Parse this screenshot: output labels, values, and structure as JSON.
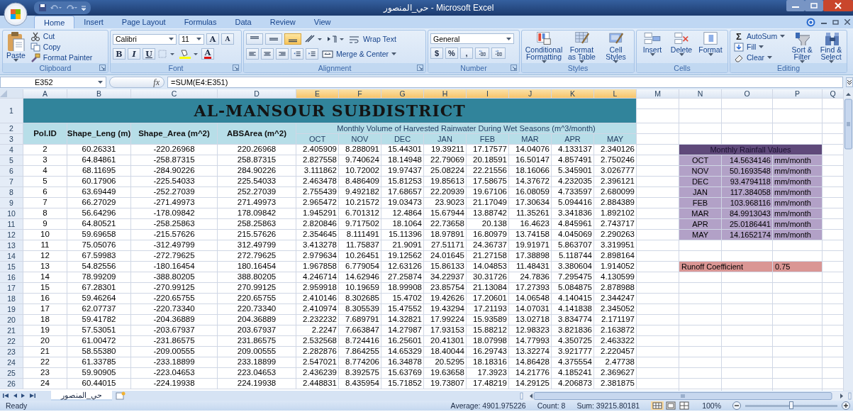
{
  "window": {
    "title": "حي_المنصور - Microsoft Excel"
  },
  "ribbon_tabs": [
    {
      "label": "Home",
      "selected": true
    },
    {
      "label": "Insert",
      "selected": false
    },
    {
      "label": "Page Layout",
      "selected": false
    },
    {
      "label": "Formulas",
      "selected": false
    },
    {
      "label": "Data",
      "selected": false
    },
    {
      "label": "Review",
      "selected": false
    },
    {
      "label": "View",
      "selected": false
    }
  ],
  "ribbon": {
    "clipboard": {
      "label": "Clipboard",
      "paste": "Paste",
      "cut": "Cut",
      "copy": "Copy",
      "format_painter": "Format Painter"
    },
    "font": {
      "label": "Font",
      "family": "Calibri",
      "size": "11",
      "grow": "A",
      "shrink": "A",
      "bold": "B",
      "italic": "I",
      "underline": "U",
      "font_color": "A"
    },
    "alignment": {
      "label": "Alignment",
      "vertical_align": [
        {
          "selected": false
        },
        {
          "selected": false
        },
        {
          "selected": true
        }
      ],
      "wrap_text": "Wrap Text",
      "merge_center": "Merge & Center"
    },
    "number": {
      "label": "Number",
      "format": "General",
      "currency": "$",
      "percent": "%",
      "comma": ","
    },
    "styles": {
      "label": "Styles",
      "buttons": [
        "Conditional Formatting",
        "Format as Table",
        "Cell Styles"
      ]
    },
    "cells": {
      "label": "Cells",
      "buttons": [
        "Insert",
        "Delete",
        "Format"
      ]
    },
    "editing": {
      "label": "Editing",
      "sigma": "Σ",
      "autosum": "AutoSum",
      "fill": "Fill",
      "clear": "Clear",
      "sort_filter": "Sort & Filter",
      "find_select": "Find & Select"
    }
  },
  "formula_bar": {
    "name_box": "E352",
    "fx": "fx",
    "formula": "=SUM(E4:E351)"
  },
  "column_headers": [
    {
      "label": "A",
      "selected": false
    },
    {
      "label": "B",
      "selected": false
    },
    {
      "label": "C",
      "selected": false
    },
    {
      "label": "D",
      "selected": false
    },
    {
      "label": "E",
      "selected": true
    },
    {
      "label": "F",
      "selected": true
    },
    {
      "label": "G",
      "selected": true
    },
    {
      "label": "H",
      "selected": true
    },
    {
      "label": "I",
      "selected": true
    },
    {
      "label": "J",
      "selected": true
    },
    {
      "label": "K",
      "selected": true
    },
    {
      "label": "L",
      "selected": true
    },
    {
      "label": "M",
      "selected": false
    },
    {
      "label": "N",
      "selected": false
    },
    {
      "label": "O",
      "selected": false
    },
    {
      "label": "P",
      "selected": false
    },
    {
      "label": "Q",
      "selected": false
    }
  ],
  "row_numbers": [
    "1",
    "2",
    "3",
    "4",
    "5",
    "6",
    "7",
    "8",
    "9",
    "10",
    "11",
    "12",
    "13",
    "14",
    "15",
    "16",
    "17",
    "18",
    "19",
    "20",
    "21",
    "22",
    "23",
    "24",
    "25",
    "26"
  ],
  "sheet": {
    "title": "AL-MANSOUR SUBDISTRICT",
    "columns": [
      "Pol.ID",
      "Shape_Leng (m)",
      "Shape_Area (m^2)",
      "ABSArea (m^2)"
    ],
    "monthly_header": "Monthly Volume of Harvested Rainwater During Wet Seasons (m^3/month)",
    "months": [
      "OCT",
      "NOV",
      "DEC",
      "JAN",
      "FEB",
      "MAR",
      "APR",
      "MAY"
    ],
    "rows": [
      [
        "2",
        "60.26331",
        "-220.26968",
        "220.26968",
        "2.405909",
        "8.288091",
        "15.44301",
        "19.39211",
        "17.17577",
        "14.04076",
        "4.133137",
        "2.340126"
      ],
      [
        "3",
        "64.84861",
        "-258.87315",
        "258.87315",
        "2.827558",
        "9.740624",
        "18.14948",
        "22.79069",
        "20.18591",
        "16.50147",
        "4.857491",
        "2.750246"
      ],
      [
        "4",
        "68.11695",
        "-284.90226",
        "284.90226",
        "3.111862",
        "10.72002",
        "19.97437",
        "25.08224",
        "22.21556",
        "18.16066",
        "5.345901",
        "3.026777"
      ],
      [
        "5",
        "60.17906",
        "-225.54033",
        "225.54033",
        "2.463478",
        "8.486409",
        "15.81253",
        "19.85613",
        "17.58675",
        "14.37672",
        "4.232035",
        "2.396121"
      ],
      [
        "6",
        "63.69449",
        "-252.27039",
        "252.27039",
        "2.755439",
        "9.492182",
        "17.68657",
        "22.20939",
        "19.67106",
        "16.08059",
        "4.733597",
        "2.680099"
      ],
      [
        "7",
        "66.27029",
        "-271.49973",
        "271.49973",
        "2.965472",
        "10.21572",
        "19.03473",
        "23.9023",
        "21.17049",
        "17.30634",
        "5.094416",
        "2.884389"
      ],
      [
        "8",
        "56.64296",
        "-178.09842",
        "178.09842",
        "1.945291",
        "6.701312",
        "12.4864",
        "15.67944",
        "13.88742",
        "11.35261",
        "3.341836",
        "1.892102"
      ],
      [
        "9",
        "64.80521",
        "-258.25863",
        "258.25863",
        "2.820846",
        "9.717502",
        "18.1064",
        "22.73658",
        "20.138",
        "16.4623",
        "4.845961",
        "2.743717"
      ],
      [
        "10",
        "59.69658",
        "-215.57626",
        "215.57626",
        "2.354645",
        "8.111491",
        "15.11396",
        "18.97891",
        "16.80979",
        "13.74158",
        "4.045069",
        "2.290263"
      ],
      [
        "11",
        "75.05076",
        "-312.49799",
        "312.49799",
        "3.413278",
        "11.75837",
        "21.9091",
        "27.51171",
        "24.36737",
        "19.91971",
        "5.863707",
        "3.319951"
      ],
      [
        "12",
        "67.59983",
        "-272.79625",
        "272.79625",
        "2.979634",
        "10.26451",
        "19.12562",
        "24.01645",
        "21.27158",
        "17.38898",
        "5.118744",
        "2.898164"
      ],
      [
        "13",
        "54.82556",
        "-180.16454",
        "180.16454",
        "1.967858",
        "6.779054",
        "12.63126",
        "15.86133",
        "14.04853",
        "11.48431",
        "3.380604",
        "1.914052"
      ],
      [
        "14",
        "78.99209",
        "-388.80205",
        "388.80205",
        "4.246714",
        "14.62946",
        "27.25874",
        "34.22937",
        "30.31726",
        "24.7836",
        "7.295475",
        "4.130599"
      ],
      [
        "15",
        "67.28301",
        "-270.99125",
        "270.99125",
        "2.959918",
        "10.19659",
        "18.99908",
        "23.85754",
        "21.13084",
        "17.27393",
        "5.084875",
        "2.878988"
      ],
      [
        "16",
        "59.46264",
        "-220.65755",
        "220.65755",
        "2.410146",
        "8.302685",
        "15.4702",
        "19.42626",
        "17.20601",
        "14.06548",
        "4.140415",
        "2.344247"
      ],
      [
        "17",
        "62.07737",
        "-220.73340",
        "220.73340",
        "2.410974",
        "8.305539",
        "15.47552",
        "19.43294",
        "17.21193",
        "14.07031",
        "4.141838",
        "2.345052"
      ],
      [
        "18",
        "59.41782",
        "-204.36889",
        "204.36889",
        "2.232232",
        "7.689791",
        "14.32821",
        "17.99224",
        "15.93589",
        "13.02718",
        "3.834774",
        "2.171197"
      ],
      [
        "19",
        "57.53051",
        "-203.67937",
        "203.67937",
        "2.2247",
        "7.663847",
        "14.27987",
        "17.93153",
        "15.88212",
        "12.98323",
        "3.821836",
        "2.163872"
      ],
      [
        "20",
        "61.00472",
        "-231.86575",
        "231.86575",
        "2.532568",
        "8.724416",
        "16.25601",
        "20.41301",
        "18.07998",
        "14.77993",
        "4.350725",
        "2.463322"
      ],
      [
        "21",
        "58.55380",
        "-209.00555",
        "209.00555",
        "2.282876",
        "7.864255",
        "14.65329",
        "18.40044",
        "16.29743",
        "13.32274",
        "3.921777",
        "2.220457"
      ],
      [
        "22",
        "61.33785",
        "-233.18899",
        "233.18899",
        "2.547021",
        "8.774206",
        "16.34878",
        "20.5295",
        "18.18316",
        "14.86428",
        "4.375554",
        "2.47738"
      ],
      [
        "23",
        "59.90905",
        "-223.04653",
        "223.04653",
        "2.436239",
        "8.392575",
        "15.63769",
        "19.63658",
        "17.3923",
        "14.21776",
        "4.185241",
        "2.369627"
      ],
      [
        "24",
        "60.44015",
        "-224.19938",
        "224.19938",
        "2.448831",
        "8.435954",
        "15.71852",
        "19.73807",
        "17.48219",
        "14.29125",
        "4.206873",
        "2.381875"
      ]
    ]
  },
  "rainfall": {
    "title": "Monthly Rainfall Values",
    "rows": [
      {
        "month": "OCT",
        "value": "14.5634146",
        "unit": "mm/month"
      },
      {
        "month": "NOV",
        "value": "50.1693548",
        "unit": "mm/month"
      },
      {
        "month": "DEC",
        "value": "93.4794118",
        "unit": "mm/month"
      },
      {
        "month": "JAN",
        "value": "117.384058",
        "unit": "mm/month"
      },
      {
        "month": "FEB",
        "value": "103.968116",
        "unit": "mm/month"
      },
      {
        "month": "MAR",
        "value": "84.9913043",
        "unit": "mm/month"
      },
      {
        "month": "APR",
        "value": "25.0186441",
        "unit": "mm/month"
      },
      {
        "month": "MAY",
        "value": "14.1652174",
        "unit": "mm/month"
      }
    ]
  },
  "runoff": {
    "label": "Runoff Coefficient",
    "value": "0.75"
  },
  "sheet_tabs": [
    {
      "label": "حي_المنصور",
      "selected": true
    }
  ],
  "status_bar": {
    "mode": "Ready",
    "average": "Average: 4901.975226",
    "count": "Count: 8",
    "sum": "Sum: 39215.80181",
    "zoom": "100%",
    "zoom_slider": {
      "level": 0.5
    }
  }
}
